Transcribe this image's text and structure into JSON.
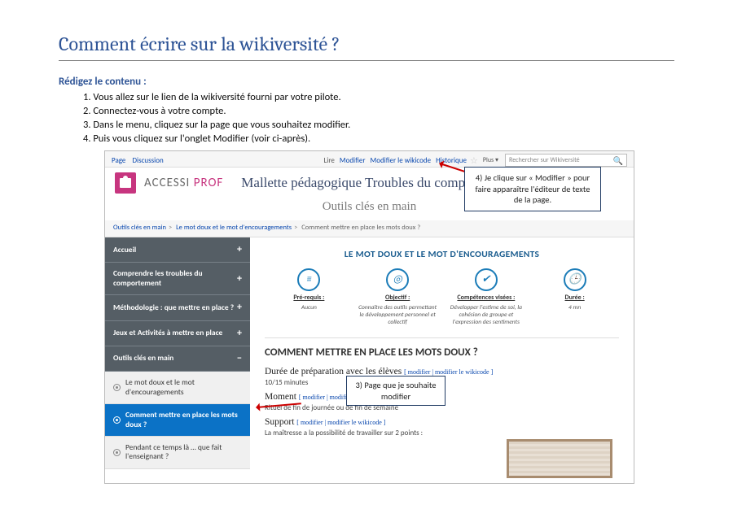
{
  "doc": {
    "title": "Comment écrire sur la wikiversité   ?",
    "section_label": "Rédigez le contenu :",
    "steps": [
      "Vous allez sur le lien de la wikiversité fourni par votre pilote.",
      "Connectez-vous à votre compte.",
      "Dans le menu, cliquez sur la page que vous souhaitez modifier.",
      "Puis vous cliquez sur l'onglet Modifier (voir ci-après)."
    ],
    "step4_em": "Modifier"
  },
  "callouts": {
    "c4": "4) Je clique sur « Modifier » pour faire apparaître l'éditeur de texte de la page.",
    "c3": "3) Page que je souhaite modifier"
  },
  "wiki": {
    "tabs_left": {
      "page": "Page",
      "discussion": "Discussion"
    },
    "tabs_right": {
      "lire": "Lire",
      "modifier": "Modifier",
      "wikicode": "Modifier le wikicode",
      "historique": "Historique",
      "plus": "Plus"
    },
    "search_placeholder": "Rechercher sur Wikiversité",
    "brand1": "ACCESSI",
    "brand2": " PROF",
    "mallette": "Mallette pédagogique Troubles du comportement",
    "subhead": "Outils clés en main",
    "breadcrumb": {
      "a": "Outils clés en main",
      "b": "Le mot doux et le mot d'encouragements",
      "c": "Comment mettre en place les mots doux ?"
    },
    "sidebar": {
      "accueil": "Accueil",
      "comprendre": "Comprendre les troubles du comportement",
      "methodo": "Méthodologie : que mettre en place ?",
      "jeux": "Jeux et Activités à mettre en place",
      "outils": "Outils clés en main",
      "motdoux": "Le mot doux et le mot d'encouragements",
      "comment": "Comment mettre en place les mots doux ?",
      "pendant": "Pendant ce temps là … que fait l'enseignant ?"
    },
    "content": {
      "top_title": "LE MOT DOUX ET LE MOT D'ENCOURAGEMENTS",
      "cols": {
        "prerequis_l": "Pré-requis :",
        "prerequis_t": "Aucun",
        "objectif_l": "Objectif :",
        "objectif_t": "Connaître des outils permettant le développement personnel et collectif",
        "comp_l": "Compétences visées :",
        "comp_t": "Développer l'estime de soi, la cohésion de groupe et l'expression des sentiments",
        "duree_l": "Durée :",
        "duree_t": "4 mn"
      },
      "h2": "COMMENT METTRE EN PLACE LES MOTS DOUX ?",
      "duree_h": "Durée de préparation avec les élèves",
      "duree_v": "10/15 minutes",
      "moment_h": "Moment",
      "moment_t": "Rituel de fin de journée ou de fin de semaine",
      "support_h": "Support",
      "support_t": "La maîtresse a la possibilité de travailler sur 2 points :",
      "modlink": "[ modifier | modifier le wikicode ]"
    }
  }
}
